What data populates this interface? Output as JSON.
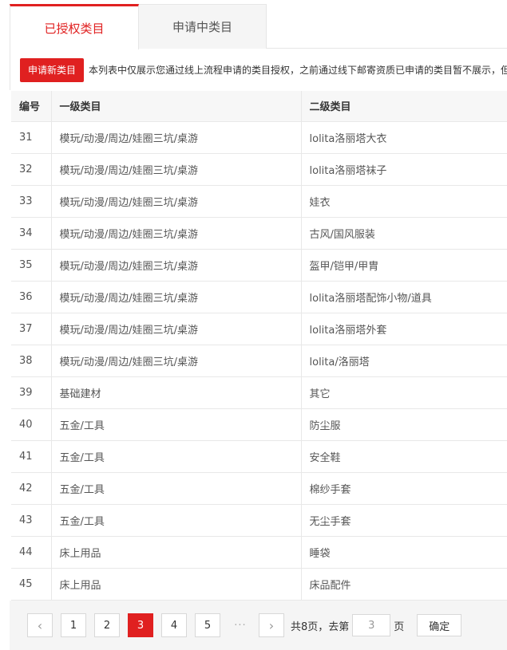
{
  "tabs": [
    {
      "label": "已授权类目"
    },
    {
      "label": "申请中类目"
    }
  ],
  "notice": {
    "button_label": "申请新类目",
    "text": "本列表中仅展示您通过线上流程申请的类目授权，之前通过线下邮寄资质已申请的类目暂不展示，但"
  },
  "table": {
    "headers": {
      "no": "编号",
      "level1": "一级类目",
      "level2": "二级类目"
    },
    "rows": [
      {
        "no": "31",
        "level1": "模玩/动漫/周边/娃圈三坑/桌游",
        "level2": "lolita洛丽塔大衣"
      },
      {
        "no": "32",
        "level1": "模玩/动漫/周边/娃圈三坑/桌游",
        "level2": "lolita洛丽塔袜子"
      },
      {
        "no": "33",
        "level1": "模玩/动漫/周边/娃圈三坑/桌游",
        "level2": "娃衣"
      },
      {
        "no": "34",
        "level1": "模玩/动漫/周边/娃圈三坑/桌游",
        "level2": "古风/国风服装"
      },
      {
        "no": "35",
        "level1": "模玩/动漫/周边/娃圈三坑/桌游",
        "level2": "盔甲/铠甲/甲胄"
      },
      {
        "no": "36",
        "level1": "模玩/动漫/周边/娃圈三坑/桌游",
        "level2": "lolita洛丽塔配饰小物/道具"
      },
      {
        "no": "37",
        "level1": "模玩/动漫/周边/娃圈三坑/桌游",
        "level2": "lolita洛丽塔外套"
      },
      {
        "no": "38",
        "level1": "模玩/动漫/周边/娃圈三坑/桌游",
        "level2": "lolita/洛丽塔"
      },
      {
        "no": "39",
        "level1": "基础建材",
        "level2": "其它"
      },
      {
        "no": "40",
        "level1": "五金/工具",
        "level2": "防尘服"
      },
      {
        "no": "41",
        "level1": "五金/工具",
        "level2": "安全鞋"
      },
      {
        "no": "42",
        "level1": "五金/工具",
        "level2": "棉纱手套"
      },
      {
        "no": "43",
        "level1": "五金/工具",
        "level2": "无尘手套"
      },
      {
        "no": "44",
        "level1": "床上用品",
        "level2": "睡袋"
      },
      {
        "no": "45",
        "level1": "床上用品",
        "level2": "床品配件"
      }
    ]
  },
  "pagination": {
    "prev_icon": "‹",
    "next_icon": "›",
    "pages": [
      "1",
      "2",
      "3",
      "4",
      "5"
    ],
    "active_page": "3",
    "ellipsis": "···",
    "total_text": "共8页，去第",
    "goto_value": "3",
    "page_suffix": "页",
    "confirm_label": "确定"
  }
}
